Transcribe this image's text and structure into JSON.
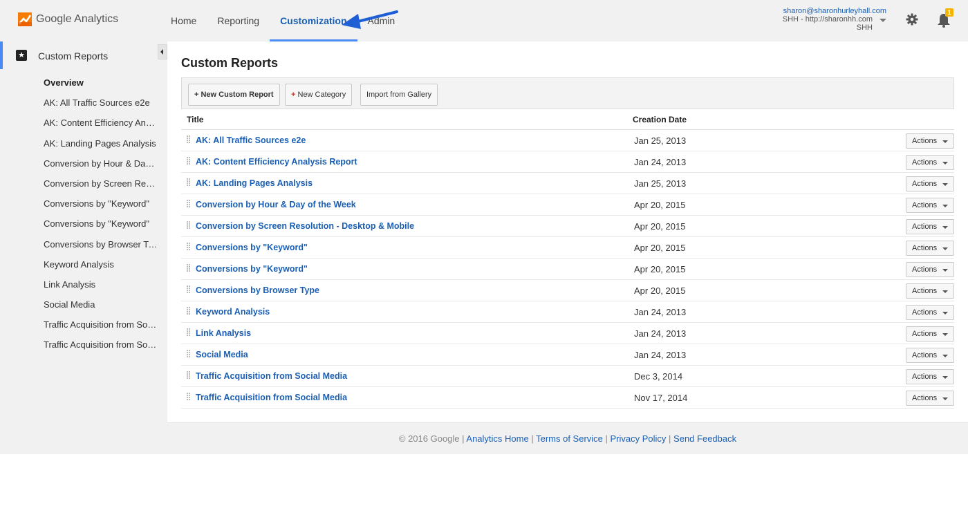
{
  "header": {
    "logo_text": "Google Analytics",
    "nav": [
      {
        "label": "Home"
      },
      {
        "label": "Reporting"
      },
      {
        "label": "Customization"
      },
      {
        "label": "Admin"
      }
    ],
    "account_email": "sharon@sharonhurleyhall.com",
    "account_property": "SHH - http://sharonhh.com",
    "account_view": "SHH",
    "notification_count": "1",
    "accent_color": "#1a5fb4",
    "badge_color": "#f4b400"
  },
  "sidebar": {
    "title": "Custom Reports",
    "items": [
      {
        "label": "Overview"
      },
      {
        "label": "AK: All Traffic Sources e2e"
      },
      {
        "label": "AK: Content Efficiency Analysis Report"
      },
      {
        "label": "AK: Landing Pages Analysis"
      },
      {
        "label": "Conversion by Hour & Day of the Week"
      },
      {
        "label": "Conversion by Screen Resolution - Desktop & Mobile"
      },
      {
        "label": "Conversions by \"Keyword\""
      },
      {
        "label": "Conversions by \"Keyword\""
      },
      {
        "label": "Conversions by Browser Type"
      },
      {
        "label": "Keyword Analysis"
      },
      {
        "label": "Link Analysis"
      },
      {
        "label": "Social Media"
      },
      {
        "label": "Traffic Acquisition from Social Media"
      },
      {
        "label": "Traffic Acquisition from Social Media"
      }
    ]
  },
  "main": {
    "title": "Custom Reports",
    "toolbar": {
      "new_report": "+ New Custom Report",
      "new_category_plus": "+",
      "new_category": " New Category",
      "import": "Import from Gallery"
    },
    "columns": {
      "title": "Title",
      "date": "Creation Date"
    },
    "actions_label": "Actions",
    "rows": [
      {
        "title": "AK: All Traffic Sources e2e",
        "date": "Jan 25, 2013"
      },
      {
        "title": "AK: Content Efficiency Analysis Report",
        "date": "Jan 24, 2013"
      },
      {
        "title": "AK: Landing Pages Analysis",
        "date": "Jan 25, 2013"
      },
      {
        "title": "Conversion by Hour & Day of the Week",
        "date": "Apr 20, 2015"
      },
      {
        "title": "Conversion by Screen Resolution - Desktop & Mobile",
        "date": "Apr 20, 2015"
      },
      {
        "title": "Conversions by \"Keyword\"",
        "date": "Apr 20, 2015"
      },
      {
        "title": "Conversions by \"Keyword\"",
        "date": "Apr 20, 2015"
      },
      {
        "title": "Conversions by Browser Type",
        "date": "Apr 20, 2015"
      },
      {
        "title": "Keyword Analysis",
        "date": "Jan 24, 2013"
      },
      {
        "title": "Link Analysis",
        "date": "Jan 24, 2013"
      },
      {
        "title": "Social Media",
        "date": "Jan 24, 2013"
      },
      {
        "title": "Traffic Acquisition from Social Media",
        "date": "Dec 3, 2014"
      },
      {
        "title": "Traffic Acquisition from Social Media",
        "date": "Nov 17, 2014"
      }
    ]
  },
  "footer": {
    "copyright": "© 2016 Google | ",
    "links": [
      "Analytics Home",
      "Terms of Service",
      "Privacy Policy",
      "Send Feedback"
    ],
    "separator": " | "
  }
}
